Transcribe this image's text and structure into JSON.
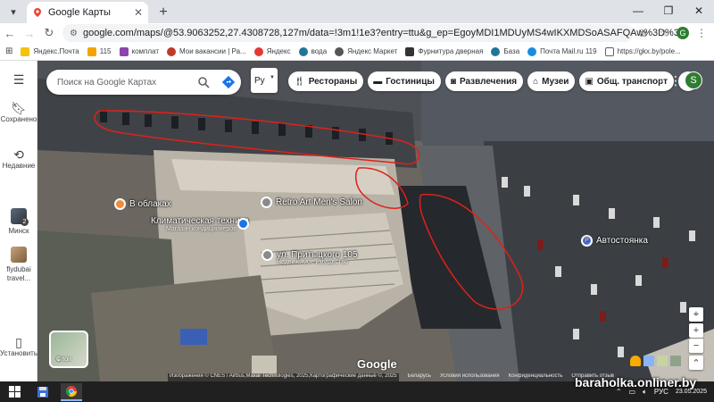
{
  "browser": {
    "tab_title": "Google Карты",
    "url": "google.com/maps/@53.9063252,27.4308728,127m/data=!3m1!1e3?entry=ttu&g_ep=EgoyMDI1MDUyMS4wIKXMDSoASAFQAw%3D%3D",
    "profile_initial": "G",
    "bookmarks": [
      {
        "label": "Яндекс.Почта",
        "color": "#f4c20d"
      },
      {
        "label": "115",
        "color": "#f4a300"
      },
      {
        "label": "комплат",
        "color": "#8e44ad"
      },
      {
        "label": "Мои вакансии | Ра...",
        "color": "#c0392b"
      },
      {
        "label": "Яндекс",
        "color": "#e53935"
      },
      {
        "label": "вода",
        "color": "#21759b"
      },
      {
        "label": "Яндекс Маркет",
        "color": "#555555"
      },
      {
        "label": "Фурнитура дверная",
        "color": "#333333"
      },
      {
        "label": "База",
        "color": "#21759b"
      },
      {
        "label": "Почта Mail.ru 119",
        "color": "#168de2"
      },
      {
        "label": "https://gkx.by/pole...",
        "color": "#888888"
      }
    ]
  },
  "rail": {
    "saved": "Сохранено",
    "recent": "Недавние",
    "minsk": "Минск",
    "minsk_badge": "2",
    "flydubai": "flydubai travel...",
    "install": "Установить"
  },
  "search": {
    "placeholder": "Поиск на Google Картах"
  },
  "lang": "Ру",
  "chips": [
    "Рестораны",
    "Гостиницы",
    "Развлечения",
    "Музеи",
    "Общ. транспорт"
  ],
  "map_avatar": "S",
  "pois": {
    "vo_blakah": "В облаках",
    "klimat": "Климатическая техника",
    "klimat_sub": "Магазин кондиционеров",
    "retro": "Retro Art Men's Salon",
    "pritytskogo": "ул. Притыцкого 105",
    "pritytskogo_sub": "Недвижимое имущество",
    "parking": "Автостоянка"
  },
  "layers_label": "Слои",
  "google_logo": "Google",
  "attribution": [
    "Изображения © CNES / Airbus,Maxar Technologies, 2025,Картографические данные ©, 2025",
    "Беларусь",
    "Условия использования",
    "Конфиденциальность",
    "Отправить отзыв"
  ],
  "watermark": "baraholka.onliner.by",
  "taskbar": {
    "lang": "РУС",
    "date": "23.05.2025"
  },
  "colors": {
    "red_outline": "#e0201a",
    "accent": "#1a73e8",
    "parking_pin": "#4a6ee0",
    "poi_pin": "#f28b3c"
  }
}
